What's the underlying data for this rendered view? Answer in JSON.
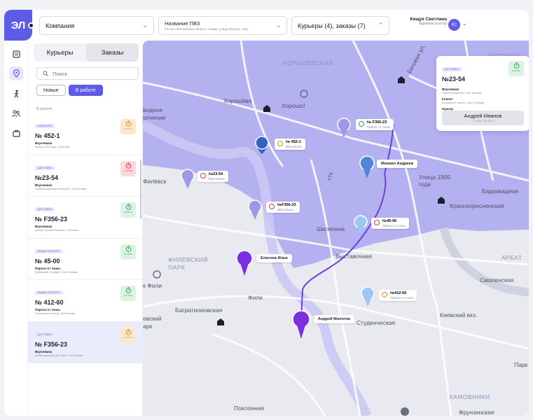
{
  "app": {
    "logo_text": "ЭЛ"
  },
  "topbar": {
    "company": {
      "value": "Компания"
    },
    "pvz": {
      "title": "Название ПВЗ",
      "address": "Россия, Московская область, Химки, улица Фёдора, 10к1"
    },
    "couriers_orders": {
      "value": "Курьеры (4), заказы (7)"
    },
    "user": {
      "name": "Кищук Светлана",
      "role": "Администратор",
      "initials": "КС"
    }
  },
  "panel": {
    "tabs": [
      {
        "label": "Курьеры"
      },
      {
        "label": "Заказы"
      }
    ],
    "search": {
      "placeholder": "Поиск"
    },
    "filters": [
      {
        "label": "Новые"
      },
      {
        "label": "В работе"
      }
    ],
    "section_title": "В работе",
    "orders": [
      {
        "status": "НАЗНАЧЕН",
        "number": "№ 452-1",
        "shop": "Вкусняшка",
        "address": "улица 1905 года, 4 Москва",
        "timer": "00:20:24",
        "timer_color": "orange"
      },
      {
        "status": "ДОСТАВКА",
        "number": "№23-54",
        "shop": "Вкусняшка",
        "address": "Страховщинский переулок, 13А Москва",
        "timer": "-01:10:58",
        "timer_color": "red"
      },
      {
        "status": "ДОСТАВКА",
        "number": "№ F356-23",
        "shop": "Вкусняшка",
        "address": "улица Сергея Макеева, 4 Москва",
        "timer": "03:01:04",
        "timer_color": "green"
      },
      {
        "status": "ВЫДАН КУРЬЕРУ",
        "number": "№ 45-00",
        "shop": "Пироги от Анны",
        "address": "Зубовский бульвар, 13к3 Москва",
        "timer": "01:15:09",
        "timer_color": "green"
      },
      {
        "status": "ВЫДАН КУРЬЕРУ",
        "number": "№ 412-60",
        "shop": "Пироги от Анны",
        "address": "Покровская улица, 3к2 Москва",
        "timer": "01:15:09",
        "timer_color": "green"
      },
      {
        "status": "ДОСТАВКА",
        "number": "№ F356-23",
        "shop": "Вкусняшка",
        "address": "Ленинградский проспект, 3к2 Москва",
        "timer": "00:20:24",
        "timer_color": "orange"
      }
    ]
  },
  "map": {
    "labels": {
      "khoroshevsky": "ХОРОШЁВСКИЙ",
      "begovoy": "БЕГОВОЙ",
      "khoroshevo": "Хорошёво",
      "khoroshyo": "Хорошо!",
      "vodnoe": "водное",
      "polchenie": "олчение",
      "begovaya": "Беговая ул.",
      "ulitsa1905": "Улица 1905 года",
      "barrikadnaya": "Баррикадная",
      "krasnopresnenskaya": "Краснопресненская",
      "filevsky": "ФИЛЁВСКИЙ ПАРК",
      "fili_l": "к Фили",
      "fili": "Фили",
      "shelepikha": "Шелепиха",
      "vystavochnaya": "Выставочная",
      "arbat": "АРБАТ",
      "smolenskaya": "Смоленская",
      "bagrationovskaya": "Багратионовская",
      "kievsky": "Киевский вкз.",
      "studencheskaya": "Студенческая",
      "poklonnaya": "Поклонная",
      "khamovniki": "ХАМОВНИКИ",
      "frunzenskaya": "Фрунзенская",
      "park_k": "Парк к",
      "evsky": "евский",
      "ark": "арк",
      "ttk": "ТТК",
      "filevsk": "Филёвск"
    },
    "order_pins": [
      {
        "number": "№ 452-1",
        "shop": "Вкусняшка",
        "color": "orange"
      },
      {
        "number": "№23-54",
        "shop": "Вкусняшка",
        "color": "red"
      },
      {
        "number": "№F356-23",
        "shop": "Вкусняшка",
        "color": "red"
      },
      {
        "number": "№ F356-23",
        "shop": "Пироги от Анны",
        "color": "green"
      },
      {
        "number": "№45-00",
        "shop": "Пироги от Анны",
        "color": "red"
      },
      {
        "number": "№412-60",
        "shop": "Пироги от Анны",
        "color": "orange"
      }
    ],
    "couriers": [
      {
        "name": "Михаил Андреев"
      },
      {
        "name": "Елисеев Илья"
      },
      {
        "name": "Андрей Молотов"
      }
    ]
  },
  "popup": {
    "status": "ДОСТАВКА",
    "number": "№23-54",
    "shop_label": "Вкусняшка",
    "shop_address": "Пресненский Вал, 3к2, Москва",
    "client_label": "Клиент",
    "client_address": "Каширское шоссе, 24с8, Москва,",
    "courier_label": "Курьер",
    "courier_name": "Андрей Иванов",
    "courier_phone": "+7 (321) 765-43-21",
    "timer": "00:10:54"
  },
  "colors": {
    "accent": "#5d5be8",
    "map_zone": "#b4b1f0",
    "route": "#6d3fe0"
  }
}
